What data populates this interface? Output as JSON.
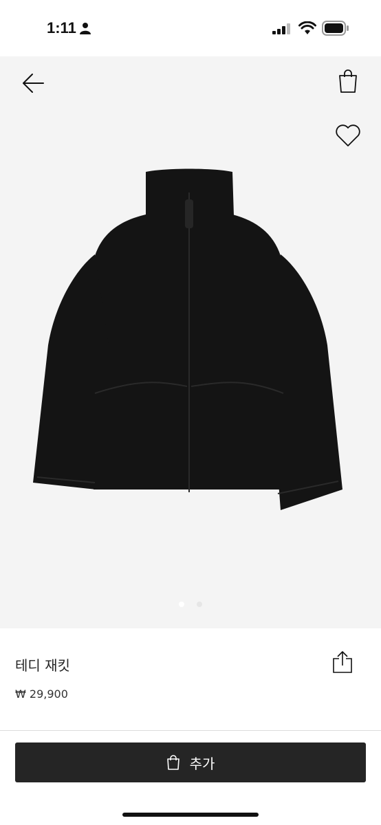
{
  "status_bar": {
    "time": "1:11"
  },
  "product": {
    "name": "테디 재킷",
    "price": "₩ 29,900",
    "image_icon": "teddy-jacket-image",
    "gallery_count": 2,
    "gallery_active_index": 0
  },
  "actions": {
    "add_label": "추가"
  },
  "icons": {
    "back": "arrow-left-icon",
    "bag": "shopping-bag-icon",
    "favorite": "heart-icon",
    "share": "share-icon",
    "add": "shopping-bag-icon"
  },
  "colors": {
    "button_bg": "#252525",
    "gallery_bg": "#f4f4f4",
    "product": "#141414"
  }
}
